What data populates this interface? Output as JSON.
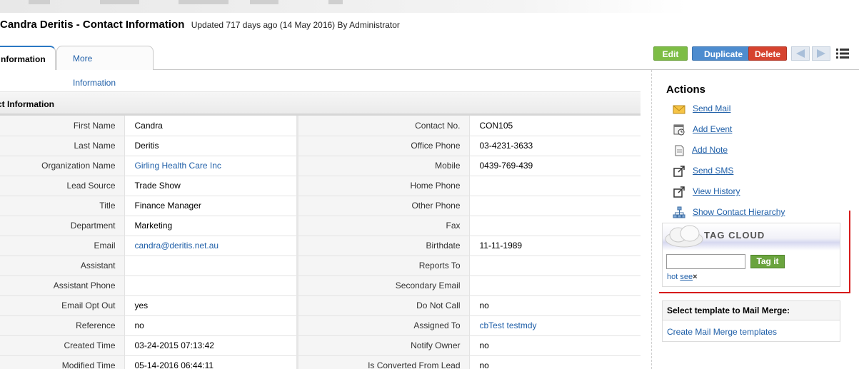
{
  "header": {
    "title": "Candra Deritis - Contact Information",
    "updated": "Updated 717 days ago (14 May 2016) By Administrator"
  },
  "tabs": [
    {
      "label": "Contact Information",
      "shown": "nformation",
      "active": true
    },
    {
      "label": "More Information",
      "active": false
    }
  ],
  "toolbar": {
    "edit_label": "Edit",
    "duplicate_label": "Duplicate",
    "delete_label": "Delete",
    "colors": {
      "edit": "#7dbd45",
      "duplicate": "#4d8ccf",
      "delete": "#d6432f"
    }
  },
  "block": {
    "title": "Contact Information",
    "shown_title": "ct Information"
  },
  "fields_left": [
    {
      "label": "First Name",
      "value": "Candra"
    },
    {
      "label": "Last Name",
      "value": "Deritis"
    },
    {
      "label": "Organization Name",
      "value": "Girling Health Care Inc",
      "link": true
    },
    {
      "label": "Lead Source",
      "value": "Trade Show"
    },
    {
      "label": "Title",
      "value": "Finance Manager"
    },
    {
      "label": "Department",
      "value": "Marketing"
    },
    {
      "label": "Email",
      "value": "candra@deritis.net.au",
      "link": true
    },
    {
      "label": "Assistant",
      "value": ""
    },
    {
      "label": "Assistant Phone",
      "value": ""
    },
    {
      "label": "Email Opt Out",
      "value": "yes"
    },
    {
      "label": "Reference",
      "value": "no"
    },
    {
      "label": "Created Time",
      "value": "03-24-2015 07:13:42"
    },
    {
      "label": "Modified Time",
      "value": "05-14-2016 06:44:11"
    }
  ],
  "fields_right": [
    {
      "label": "Contact No.",
      "value": "CON105"
    },
    {
      "label": "Office Phone",
      "value": "03-4231-3633"
    },
    {
      "label": "Mobile",
      "value": "0439-769-439"
    },
    {
      "label": "Home Phone",
      "value": ""
    },
    {
      "label": "Other Phone",
      "value": ""
    },
    {
      "label": "Fax",
      "value": ""
    },
    {
      "label": "Birthdate",
      "value": "11-11-1989"
    },
    {
      "label": "Reports To",
      "value": ""
    },
    {
      "label": "Secondary Email",
      "value": ""
    },
    {
      "label": "Do Not Call",
      "value": "no"
    },
    {
      "label": "Assigned To",
      "value": "cbTest testmdy",
      "link": true
    },
    {
      "label": "Notify Owner",
      "value": "no"
    },
    {
      "label": "Is Converted From Lead",
      "value": "no"
    }
  ],
  "sidebar": {
    "actions_title": "Actions",
    "actions": [
      {
        "label": "Send Mail",
        "icon": "envelope-icon"
      },
      {
        "label": "Add Event",
        "icon": "calendar-icon"
      },
      {
        "label": "Add Note",
        "icon": "note-icon"
      },
      {
        "label": "Send SMS",
        "icon": "external-link-icon"
      },
      {
        "label": "View History",
        "icon": "external-link-icon"
      },
      {
        "label": "Show Contact Hierarchy",
        "icon": "hierarchy-icon"
      }
    ],
    "tag_cloud": {
      "title": "TAG CLOUD",
      "button_label": "Tag it",
      "input_value": "",
      "tags": [
        "hot",
        "see"
      ],
      "remove_glyph": "×"
    },
    "mail_merge": {
      "header": "Select template to Mail Merge:",
      "link": "Create Mail Merge templates"
    }
  }
}
